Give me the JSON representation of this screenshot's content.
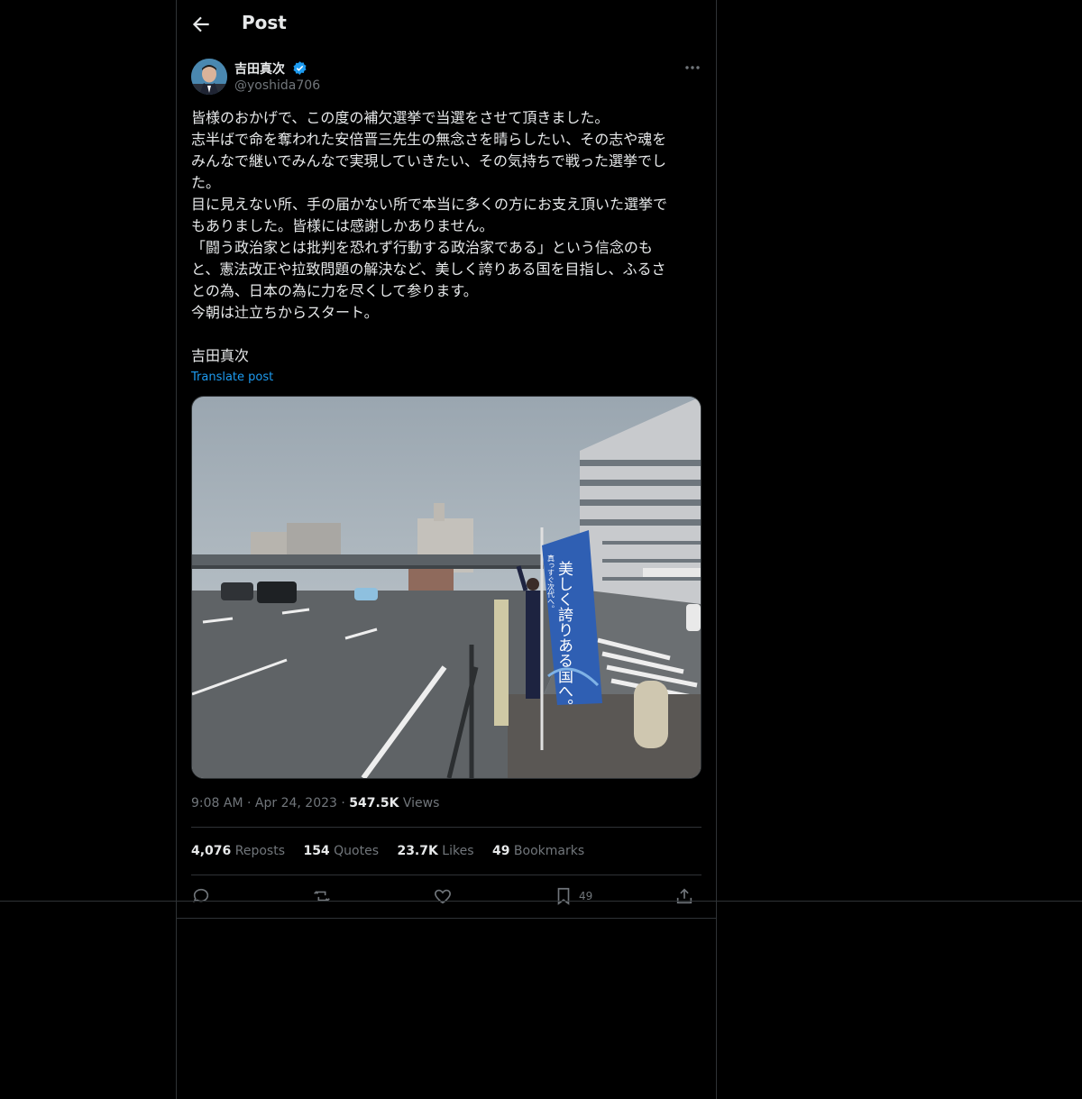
{
  "header": {
    "title": "Post"
  },
  "author": {
    "name": "吉田真次",
    "handle": "@yoshida706"
  },
  "post": {
    "text": "皆様のおかげで、この度の補欠選挙で当選をさせて頂きました。\n志半ばで命を奪われた安倍晋三先生の無念さを晴らしたい、その志や魂を\nみんなで継いでみんなで実現していきたい、その気持ちで戦った選挙でし\nた。\n目に見えない所、手の届かない所で本当に多くの方にお支え頂いた選挙で\nもありました。皆様には感謝しかありません。\n「闘う政治家とは批判を恐れず行動する政治家である」という信念のも\nと、憲法改正や拉致問題の解決など、美しく誇りある国を目指し、ふるさ\nとの為、日本の為に力を尽くして参ります。\n今朝は辻立ちからスタート。\n\n吉田真次",
    "translate_label": "Translate post",
    "media_banner_text": "美しく誇りある国へ。",
    "media_banner_subtext": "真っすぐ次代へ。"
  },
  "meta": {
    "time": "9:08 AM",
    "date": "Apr 24, 2023",
    "views_count": "547.5K",
    "views_label": "Views",
    "separator": "·"
  },
  "stats": {
    "reposts_count": "4,076",
    "reposts_label": "Reposts",
    "quotes_count": "154",
    "quotes_label": "Quotes",
    "likes_count": "23.7K",
    "likes_label": "Likes",
    "bookmarks_count": "49",
    "bookmarks_label": "Bookmarks"
  },
  "actions": {
    "bookmark_count": "49"
  },
  "icons": [
    "back-arrow-icon",
    "verified-badge-icon",
    "more-icon",
    "reply-icon",
    "repost-icon",
    "like-icon",
    "bookmark-icon",
    "share-icon"
  ],
  "colors": {
    "background": "#000000",
    "text": "#e7e9ea",
    "secondary": "#71767b",
    "link": "#1d9bf0",
    "border": "#2f3336",
    "verified": "#1d9bf0"
  }
}
